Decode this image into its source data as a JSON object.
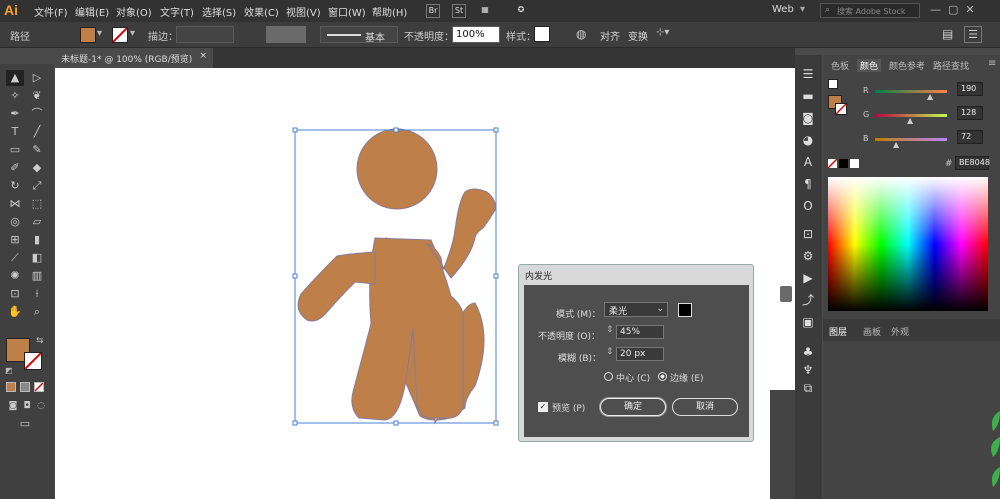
{
  "app": {
    "logo": "Ai",
    "workspace": "Web",
    "search_placeholder": "搜索 Adobe Stock"
  },
  "menu": [
    "文件(F)",
    "编辑(E)",
    "对象(O)",
    "文字(T)",
    "选择(S)",
    "效果(C)",
    "视图(V)",
    "窗口(W)",
    "帮助(H)"
  ],
  "bridge": {
    "br": "Br",
    "st": "St"
  },
  "control": {
    "selection": "路径",
    "stroke_label": "描边：",
    "stroke_style": "基本",
    "opacity_label": "不透明度：",
    "opacity_value": "100%",
    "style_label": "样式：",
    "align": "对齐",
    "transform": "变换"
  },
  "document": {
    "tab_title": "未标题-1* @ 100% (RGB/预览)",
    "close": "×"
  },
  "color_panel": {
    "tabs": [
      "色板",
      "颜色",
      "颜色参考",
      "路径查找"
    ],
    "active_tab": "颜色",
    "R": "190",
    "G": "128",
    "B": "72",
    "hex": "BE8048",
    "fill_color": "#be8048"
  },
  "layers_panel": {
    "tabs": [
      "图层",
      "画板",
      "外观"
    ]
  },
  "dialog": {
    "title": "内发光",
    "mode_label": "模式 (M)：",
    "mode_value": "柔光",
    "opacity_label": "不透明度 (O)：",
    "opacity_value": "45%",
    "blur_label": "模糊 (B)：",
    "blur_value": "20 px",
    "center_label": "中心 (C)",
    "edge_label": "边缘 (E)",
    "preview_label": "预览 (P)",
    "ok": "确定",
    "cancel": "取消",
    "selected_source": "edge",
    "preview_checked": true
  },
  "artwork": {
    "fill": "#be8048",
    "stroke": "#8a7a9a"
  }
}
